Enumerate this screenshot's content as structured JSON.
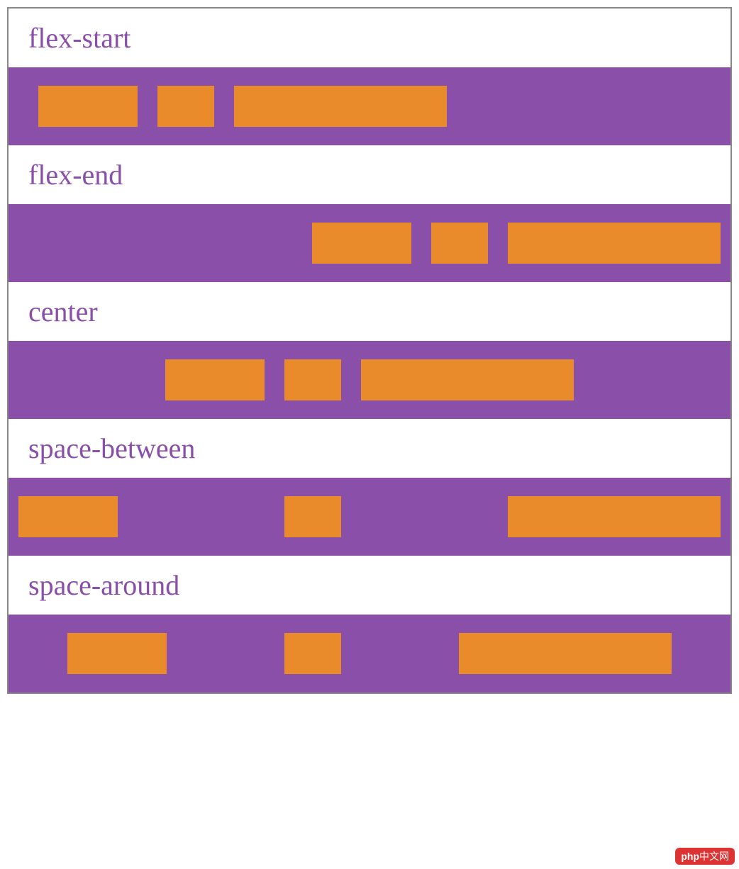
{
  "sections": [
    {
      "label": "flex-start",
      "justify": "flex-start",
      "boxes": [
        "big",
        "small",
        "wide"
      ]
    },
    {
      "label": "flex-end",
      "justify": "flex-end",
      "boxes": [
        "big",
        "small",
        "wide"
      ]
    },
    {
      "label": "center",
      "justify": "center",
      "boxes": [
        "big",
        "small",
        "wide"
      ]
    },
    {
      "label": "space-between",
      "justify": "space-between",
      "boxes": [
        "big",
        "small",
        "wide"
      ]
    },
    {
      "label": "space-around",
      "justify": "space-around",
      "boxes": [
        "big",
        "small",
        "wide"
      ]
    }
  ],
  "watermark": {
    "prefix": "php",
    "text": "中文网"
  },
  "colors": {
    "container_bg": "#8a4fa8",
    "box_bg": "#e98b2a",
    "label_color": "#8a4fa8"
  }
}
